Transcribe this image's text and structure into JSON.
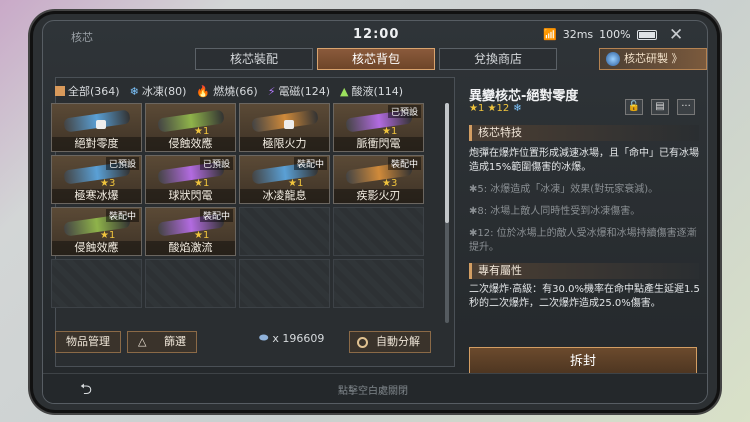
{
  "header": {
    "title": "核芯",
    "time": "12:00",
    "wifi": "32ms",
    "battery": "100%",
    "close": "✕"
  },
  "tabs": [
    {
      "label": "核芯裝配"
    },
    {
      "label": "核芯背包"
    },
    {
      "label": "兌換商店"
    }
  ],
  "research_button": "核芯研製 》",
  "filters": [
    {
      "label": "全部(364)",
      "color": "#d99a5b"
    },
    {
      "label": "冰凍(80)",
      "color": "#7ec6ff"
    },
    {
      "label": "燃燒(66)",
      "color": "#ff8a3d"
    },
    {
      "label": "電磁(124)",
      "color": "#b47bff"
    },
    {
      "label": "酸液(114)",
      "color": "#9be15d"
    }
  ],
  "items": [
    {
      "name": "絕對零度",
      "badge": "",
      "stars": "",
      "gun_color": "#5aa0d6",
      "lock": true
    },
    {
      "name": "侵蝕效應",
      "badge": "",
      "stars": "★1",
      "gun_color": "#8fb34a",
      "lock": false
    },
    {
      "name": "極限火力",
      "badge": "",
      "stars": "",
      "gun_color": "#d08a3a",
      "lock": true
    },
    {
      "name": "脈衝閃電",
      "badge": "已預設",
      "stars": "★1",
      "gun_color": "#b26be0",
      "lock": false
    },
    {
      "name": "極寒冰爆",
      "badge": "已預設",
      "stars": "★3",
      "gun_color": "#5aa0d6",
      "lock": false
    },
    {
      "name": "球狀閃電",
      "badge": "已預設",
      "stars": "★1",
      "gun_color": "#b26be0",
      "lock": false
    },
    {
      "name": "冰凌龍息",
      "badge": "裝配中",
      "stars": "★1",
      "gun_color": "#5aa0d6",
      "lock": false
    },
    {
      "name": "疾影火刃",
      "badge": "裝配中",
      "stars": "★3",
      "gun_color": "#d08a3a",
      "lock": false
    },
    {
      "name": "侵蝕效應",
      "badge": "裝配中",
      "stars": "★1",
      "gun_color": "#8fb34a",
      "lock": false
    },
    {
      "name": "酸焰激流",
      "badge": "裝配中",
      "stars": "★1",
      "gun_color": "#b26be0",
      "lock": false
    }
  ],
  "buttons": {
    "manage": "物品管理",
    "filter": "篩選",
    "auto": "自動分解"
  },
  "currency": "x 196609",
  "detail": {
    "title": "異變核芯-絕對零度",
    "stars": "★1  ★12",
    "sec1": "核芯特技",
    "desc1": "炮彈在爆炸位置形成減速冰場，且「命中」已有冰場造成15%範圍傷害的冰爆。",
    "desc2": "✱5: 冰爆造成「冰凍」效果(對玩家衰減)。",
    "desc3": "✱8: 冰場上敵人同時性受到冰凍傷害。",
    "desc4": "✱12: 位於冰場上的敵人受冰爆和冰場持續傷害逐漸提升。",
    "sec2": "專有屬性",
    "desc5": "二次爆炸·高級：有30.0%機率在命中點產生延遲1.5秒的二次爆炸，二次爆炸造成25.0%傷害。",
    "unseal": "拆封"
  },
  "bottom": {
    "back": "⮌",
    "hint": "點擊空白處關閉"
  }
}
